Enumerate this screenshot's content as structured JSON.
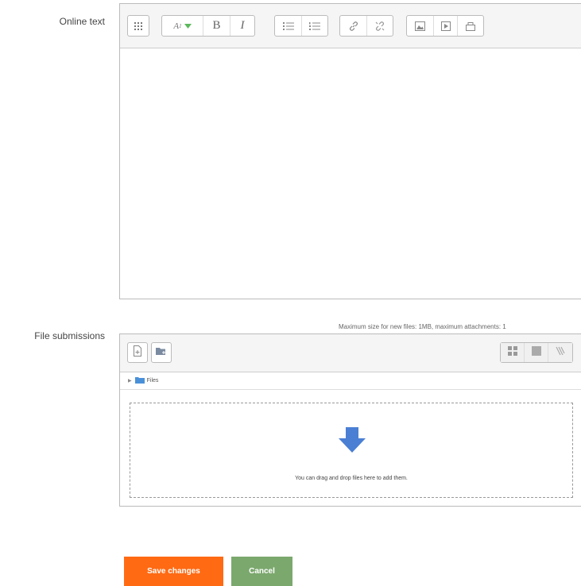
{
  "form": {
    "online_text_label": "Online text",
    "file_submissions_label": "File submissions"
  },
  "editor": {
    "toolbar_icons": [
      "toolbar-toggle-icon",
      "paragraph-style-icon",
      "bold-icon",
      "italic-icon",
      "unordered-list-icon",
      "ordered-list-icon",
      "link-icon",
      "unlink-icon",
      "image-icon",
      "media-icon",
      "manage-files-icon"
    ],
    "bold_label": "B",
    "italic_label": "I",
    "style_label": "A",
    "style_sub": "1",
    "content": ""
  },
  "files": {
    "max_note": "Maximum size for new files: 1MB, maximum attachments: 1",
    "path_folder": "Files",
    "drop_text": "You can drag and drop files here to add them.",
    "view_icons": [
      "icon-view-icon",
      "list-view-icon",
      "tree-view-icon"
    ],
    "colors": {
      "arrow": "#4a7fd4",
      "folder": "#4a90d9"
    }
  },
  "buttons": {
    "save": "Save changes",
    "cancel": "Cancel",
    "colors": {
      "save": "#ff6a13",
      "cancel": "#7ba86d"
    }
  }
}
